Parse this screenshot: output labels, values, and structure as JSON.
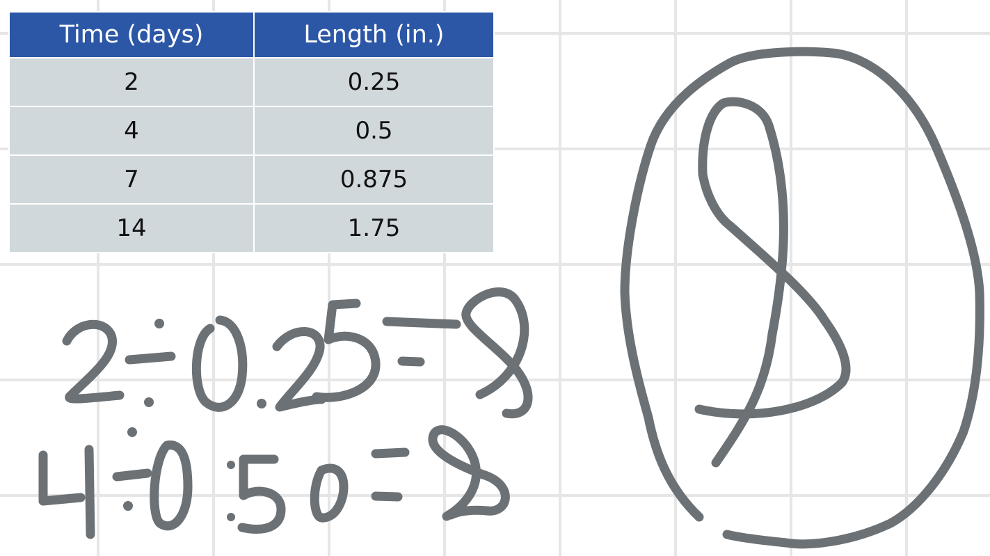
{
  "table": {
    "headers": [
      "Time (days)",
      "Length (in.)"
    ],
    "rows": [
      [
        "2",
        "0.25"
      ],
      [
        "4",
        "0.5"
      ],
      [
        "7",
        "0.875"
      ],
      [
        "14",
        "1.75"
      ]
    ]
  },
  "colors": {
    "header_bg": "#2c56a6",
    "row_bg": "#d1d8dc",
    "ink": "#6c7175",
    "grid": "#e6e6e6"
  }
}
